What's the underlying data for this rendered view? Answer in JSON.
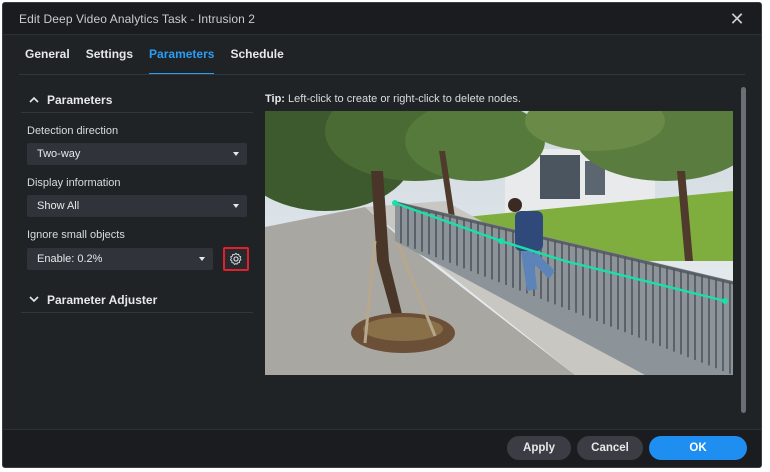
{
  "window": {
    "title": "Edit Deep Video Analytics Task - Intrusion 2",
    "close_icon": "close-icon"
  },
  "tabs": [
    {
      "label": "General",
      "active": false
    },
    {
      "label": "Settings",
      "active": false
    },
    {
      "label": "Parameters",
      "active": true
    },
    {
      "label": "Schedule",
      "active": false
    }
  ],
  "parameters": {
    "section_title": "Parameters",
    "detection_direction": {
      "label": "Detection direction",
      "value": "Two-way"
    },
    "display_information": {
      "label": "Display information",
      "value": "Show All"
    },
    "ignore_small_objects": {
      "label": "Ignore small objects",
      "value": "Enable: 0.2%"
    },
    "adjuster_title": "Parameter Adjuster"
  },
  "preview": {
    "tip_bold": "Tip:",
    "tip_text": " Left-click to create or right-click to delete nodes."
  },
  "footer": {
    "apply_label": "Apply",
    "cancel_label": "Cancel",
    "ok_label": "OK"
  },
  "colors": {
    "accent": "#2a9df4",
    "ok_button": "#1e8ff0",
    "highlight_border": "#e0202c",
    "line_node": "#19e0a8"
  }
}
